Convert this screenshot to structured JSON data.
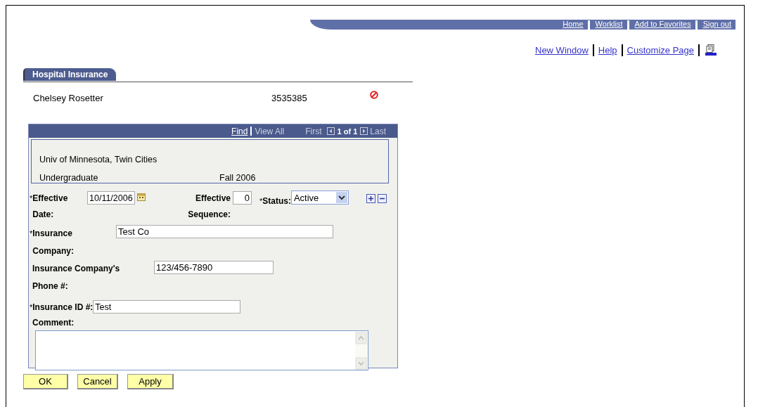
{
  "nav_links": [
    "Home",
    "Worklist",
    "Add to Favorites",
    "Sign out"
  ],
  "page_links": [
    "New Window",
    "Help",
    "Customize Page"
  ],
  "tab": {
    "label": "Hospital Insurance",
    "selected": true
  },
  "student": {
    "name": "Chelsey Rosetter",
    "id": "3535385"
  },
  "grid_header": {
    "find": "Find",
    "view_all": "View All",
    "first": "First",
    "count": "1 of 1",
    "last": "Last"
  },
  "info": {
    "institution": "Univ of Minnesota, Twin Cities",
    "career": "Undergraduate",
    "term": "Fall 2006"
  },
  "fields": {
    "effective_date": {
      "mark": "*",
      "label": "Effective Date:",
      "value": "10/11/2006"
    },
    "effective_sequence": {
      "label": "Effective Sequence:",
      "value": "0"
    },
    "status": {
      "mark": "*",
      "label": "Status:",
      "value": "Active"
    },
    "insurance_company": {
      "mark": "*",
      "label": "Insurance Company:",
      "value": "Test Co"
    },
    "company_phone": {
      "label": "Insurance Company's Phone #:",
      "value": "123/456-7890"
    },
    "insurance_id": {
      "mark": "*",
      "label": "Insurance ID #:",
      "value": "Test"
    },
    "comment": {
      "label": "Comment:"
    }
  },
  "buttons": [
    "OK",
    "Cancel",
    "Apply"
  ]
}
